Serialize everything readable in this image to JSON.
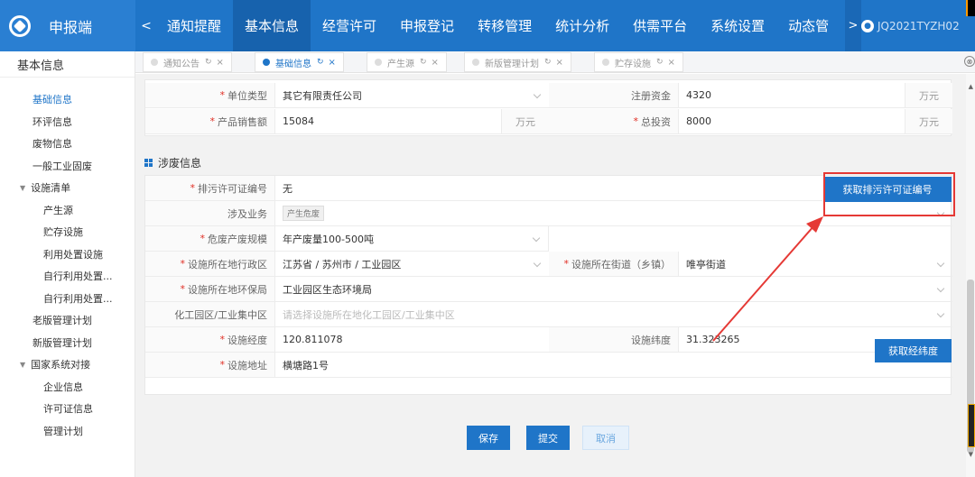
{
  "app": {
    "title": "申报端"
  },
  "nav": {
    "prev": "<",
    "items": [
      "通知提醒",
      "基本信息",
      "经营许可",
      "申报登记",
      "转移管理",
      "统计分析",
      "供需平台",
      "系统设置",
      "动态管"
    ],
    "active_index": 1,
    "next": ">",
    "user": "JQ2021TYZH02"
  },
  "sidebar": {
    "header": "基本信息",
    "items": [
      {
        "label": "基础信息",
        "level": "l1",
        "active": true
      },
      {
        "label": "环评信息",
        "level": "l1"
      },
      {
        "label": "废物信息",
        "level": "l1"
      },
      {
        "label": "一般工业固废",
        "level": "l1"
      },
      {
        "label": "设施清单",
        "level": "grp"
      },
      {
        "label": "产生源",
        "level": "l2"
      },
      {
        "label": "贮存设施",
        "level": "l2"
      },
      {
        "label": "利用处置设施",
        "level": "l2"
      },
      {
        "label": "自行利用处置...",
        "level": "l2"
      },
      {
        "label": "自行利用处置...",
        "level": "l2"
      },
      {
        "label": "老版管理计划",
        "level": "l1"
      },
      {
        "label": "新版管理计划",
        "level": "l1"
      },
      {
        "label": "国家系统对接",
        "level": "grp"
      },
      {
        "label": "企业信息",
        "level": "l2"
      },
      {
        "label": "许可证信息",
        "level": "l2"
      },
      {
        "label": "管理计划",
        "level": "l2"
      }
    ]
  },
  "tabs": [
    {
      "label": "通知公告",
      "active": false
    },
    {
      "label": "基础信息",
      "active": true
    },
    {
      "label": "产生源",
      "active": false
    },
    {
      "label": "新版管理计划",
      "active": false
    },
    {
      "label": "贮存设施",
      "active": false
    }
  ],
  "company": {
    "unit_type_label": "单位类型",
    "unit_type_value": "其它有限责任公司",
    "capital_label": "注册资金",
    "capital_value": "4320",
    "capital_unit": "万元",
    "sales_label": "产品销售额",
    "sales_value": "15084",
    "sales_unit": "万元",
    "investment_label": "总投资",
    "investment_value": "8000",
    "investment_unit": "万元"
  },
  "waste": {
    "section_title": "涉废信息",
    "permit_label": "排污许可证编号",
    "permit_value": "无",
    "permit_button": "获取排污许可证编号",
    "business_label": "涉及业务",
    "business_tag": "产生危废",
    "scale_label": "危废产废规模",
    "scale_value": "年产废量100-500吨",
    "district_label": "设施所在地行政区",
    "district_value": "江苏省 / 苏州市 / 工业园区",
    "street_label": "设施所在街道（乡镇）",
    "street_value": "唯亭街道",
    "epb_label": "设施所在地环保局",
    "epb_value": "工业园区生态环境局",
    "park_label": "化工园区/工业集中区",
    "park_placeholder": "请选择设施所在地化工园区/工业集中区",
    "lng_label": "设施经度",
    "lng_value": "120.811078",
    "lat_label": "设施纬度",
    "lat_value": "31.323265",
    "lnglat_button": "获取经纬度",
    "addr_label": "设施地址",
    "addr_value": "横塘路1号"
  },
  "actions": {
    "save": "保存",
    "submit": "提交",
    "cancel": "取消"
  },
  "colors": {
    "primary": "#1f75c8",
    "required": "#e02e24",
    "annotation": "#e53935"
  }
}
